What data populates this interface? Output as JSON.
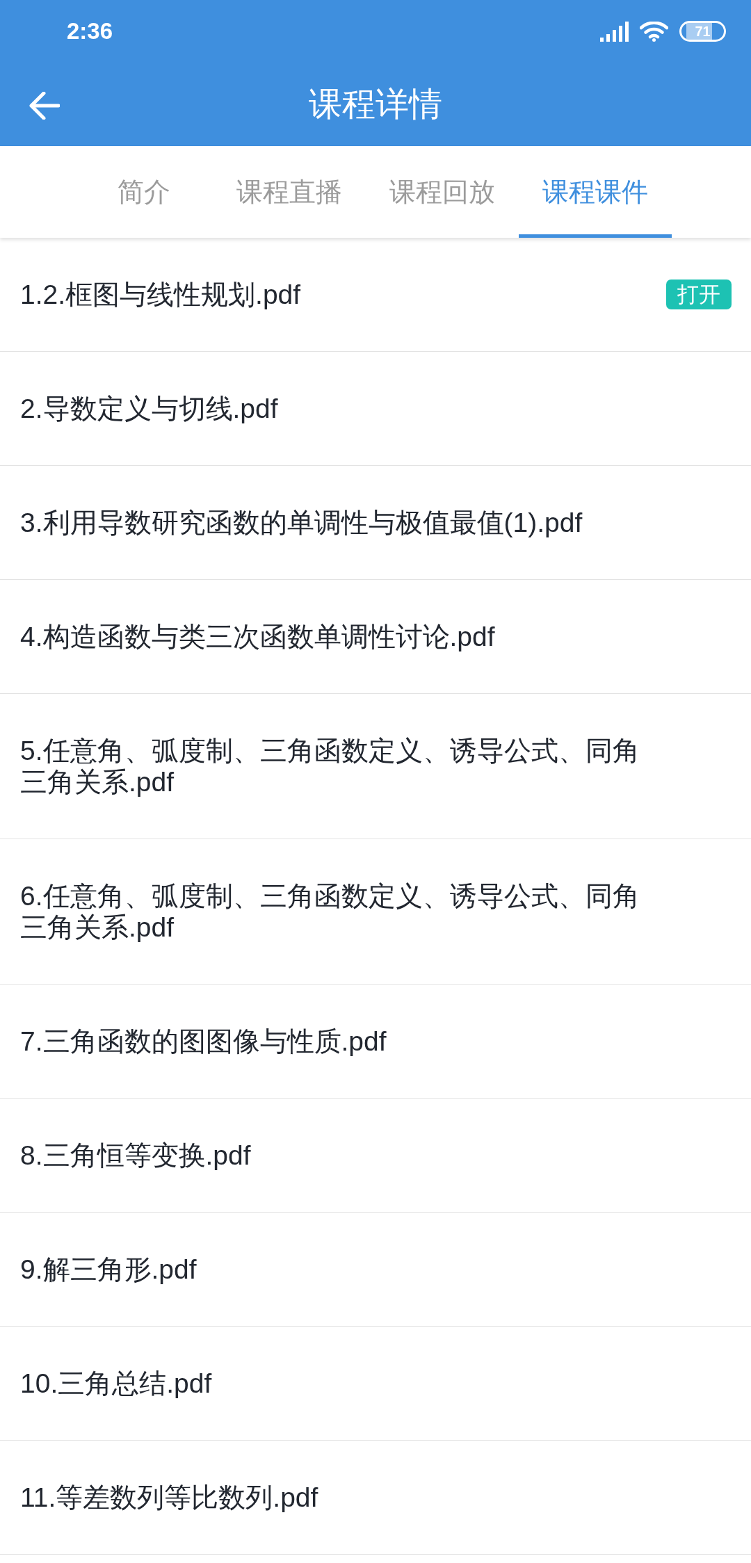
{
  "status_bar": {
    "time": "2:36",
    "battery": "71"
  },
  "header": {
    "title": "课程详情"
  },
  "tabs": [
    {
      "label": "简介",
      "selected": false
    },
    {
      "label": "课程直播",
      "selected": false
    },
    {
      "label": "课程回放",
      "selected": false
    },
    {
      "label": "课程课件",
      "selected": true
    }
  ],
  "files": [
    {
      "name": "1.2.框图与线性规划.pdf",
      "button": "打开"
    },
    {
      "name": "2.导数定义与切线.pdf"
    },
    {
      "name": "3.利用导数研究函数的单调性与极值最值(1).pdf"
    },
    {
      "name": "4.构造函数与类三次函数单调性讨论.pdf"
    },
    {
      "name": "5.任意角、弧度制、三角函数定义、诱导公式、同角三角关系.pdf"
    },
    {
      "name": "6.任意角、弧度制、三角函数定义、诱导公式、同角三角关系.pdf"
    },
    {
      "name": "7.三角函数的图图像与性质.pdf"
    },
    {
      "name": "8.三角恒等变换.pdf"
    },
    {
      "name": "9.解三角形.pdf"
    },
    {
      "name": "10.三角总结.pdf"
    },
    {
      "name": "11.等差数列等比数列.pdf"
    }
  ]
}
